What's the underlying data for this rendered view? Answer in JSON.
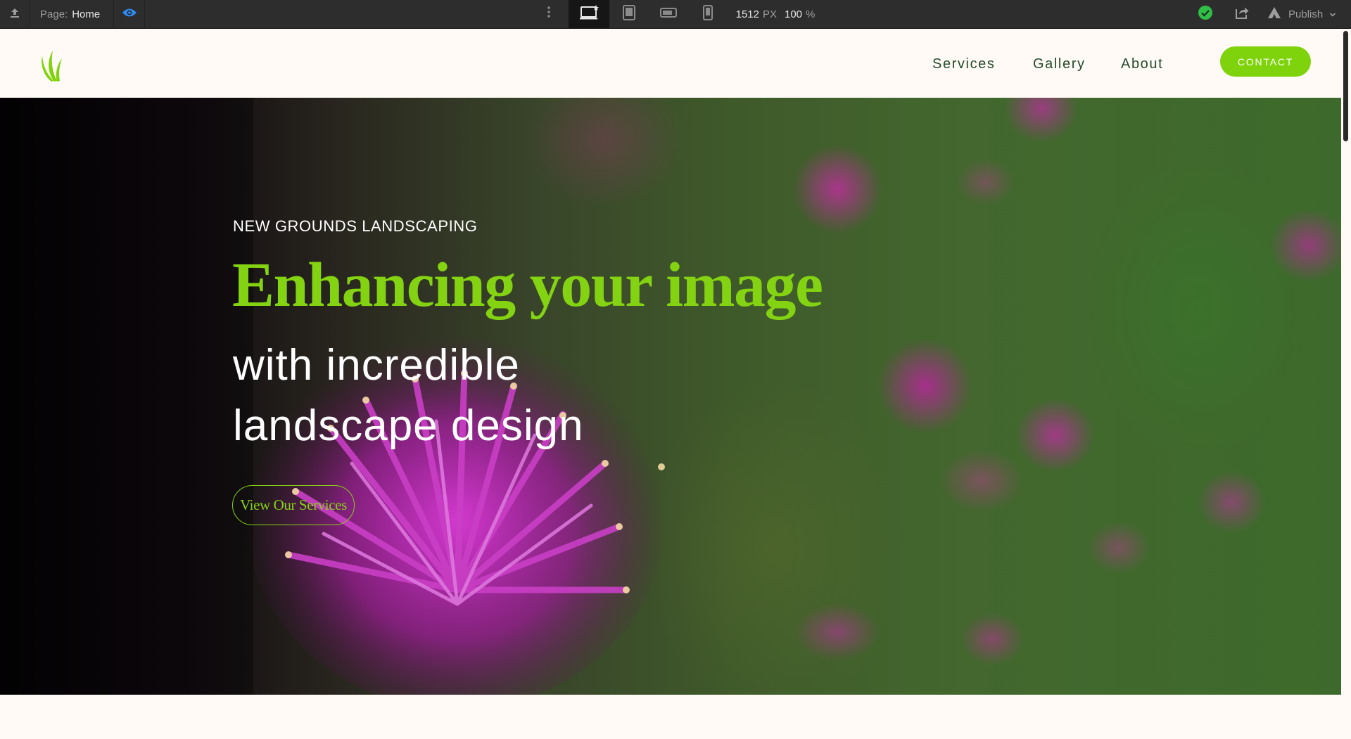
{
  "toolbar": {
    "page_label": "Page:",
    "page_name": "Home",
    "canvas_width": "1512",
    "canvas_unit": "PX",
    "zoom": "100",
    "zoom_unit": "%",
    "publish_label": "Publish",
    "icons": {
      "exit": "exit-designer-icon",
      "preview": "eye-icon",
      "more": "more-vertical-icon",
      "desktop": "desktop-icon",
      "tablet": "tablet-icon",
      "landscape": "mobile-landscape-icon",
      "phone": "mobile-portrait-icon",
      "status": "check-circle-icon",
      "export": "export-icon",
      "publish": "publish-icon",
      "chevron": "chevron-down-icon"
    },
    "colors": {
      "bg": "#2d2d2d",
      "preview_accent": "#2b8cf5",
      "status_ok": "#2fbf46"
    }
  },
  "site_nav": {
    "links": [
      "Services",
      "Gallery",
      "About"
    ],
    "contact_label": "CONTACT",
    "colors": {
      "link": "#234a2c",
      "contact_bg": "#7fd30d",
      "page_bg": "#fffaf5",
      "logo": "#7fd30d"
    }
  },
  "hero": {
    "eyebrow": "NEW GROUNDS LANDSCAPING",
    "title": "Enhancing your image",
    "subtitle_line1": "with incredible",
    "subtitle_line2": "landscape design",
    "cta_label": "View Our Services",
    "colors": {
      "accent": "#84d312",
      "text": "#ffffff",
      "flower": "#b526b4"
    }
  }
}
